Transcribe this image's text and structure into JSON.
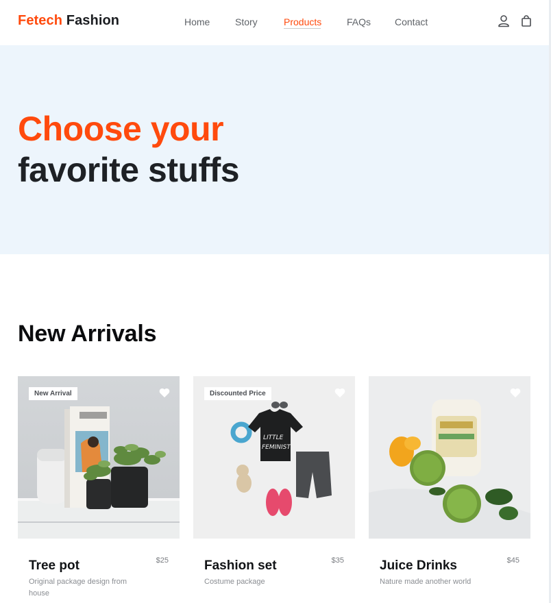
{
  "brand": {
    "accent": "Fetech",
    "rest": "Fashion"
  },
  "nav": {
    "home": "Home",
    "story": "Story",
    "products": "Products",
    "faqs": "FAQs",
    "contact": "Contact",
    "active": "Products",
    "icons": [
      "user-icon",
      "shopping-bag-icon"
    ]
  },
  "hero": {
    "line1": "Choose your",
    "line2": "favorite stuffs"
  },
  "section": {
    "title": "New Arrivals"
  },
  "products": [
    {
      "badge": "New Arrival",
      "title": "Tree pot",
      "price": "$25",
      "desc": "Original package design from house"
    },
    {
      "badge": "Discounted Price",
      "title": "Fashion set",
      "price": "$35",
      "desc": "Costume package"
    },
    {
      "badge": "",
      "title": "Juice Drinks",
      "price": "$45",
      "desc": "Nature made another world"
    }
  ],
  "colors": {
    "accent": "#ff4a0d",
    "hero_bg": "#edf5fc",
    "text": "#1e2125"
  }
}
